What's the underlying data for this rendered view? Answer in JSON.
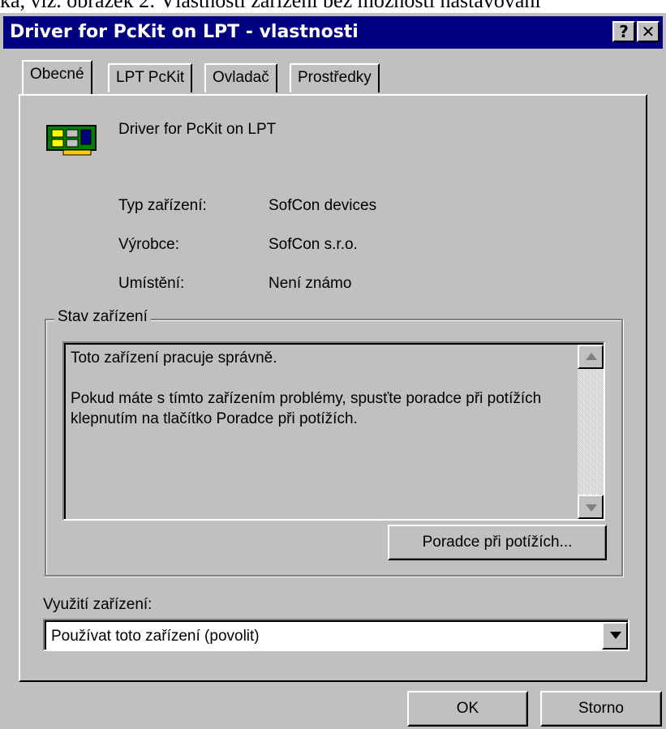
{
  "document_caption": "ka, viz. obrázek 2: Vlastnosti zařízení bez možnosti nastavování",
  "window": {
    "title": "Driver for PcKit on LPT - vlastnosti",
    "help_button": "?",
    "close_button": "✕"
  },
  "tabs": [
    {
      "label": "Obecné",
      "active": true
    },
    {
      "label": "LPT PcKit",
      "active": false
    },
    {
      "label": "Ovladač",
      "active": false
    },
    {
      "label": "Prostředky",
      "active": false
    }
  ],
  "general": {
    "device_name": "Driver for PcKit on LPT",
    "device_icon": "pci-card-icon",
    "properties": [
      {
        "label": "Typ zařízení:",
        "value": "SofCon devices"
      },
      {
        "label": "Výrobce:",
        "value": "SofCon s.r.o."
      },
      {
        "label": "Umístění:",
        "value": "Není známo"
      }
    ]
  },
  "status": {
    "group_title": "Stav zařízení",
    "line1": "Toto zařízení pracuje správně.",
    "line2": "Pokud máte s tímto zařízením problémy, spusťte poradce při potížích klepnutím na tlačítko Poradce při potížích.",
    "troubleshoot_button": "Poradce při potížích..."
  },
  "usage": {
    "label": "Využití zařízení:",
    "selected": "Používat toto zařízení (povolit)"
  },
  "footer": {
    "ok": "OK",
    "cancel": "Storno"
  },
  "colors": {
    "title_bar": "#000080",
    "face": "#c0c0c0",
    "field": "#ffffff"
  }
}
